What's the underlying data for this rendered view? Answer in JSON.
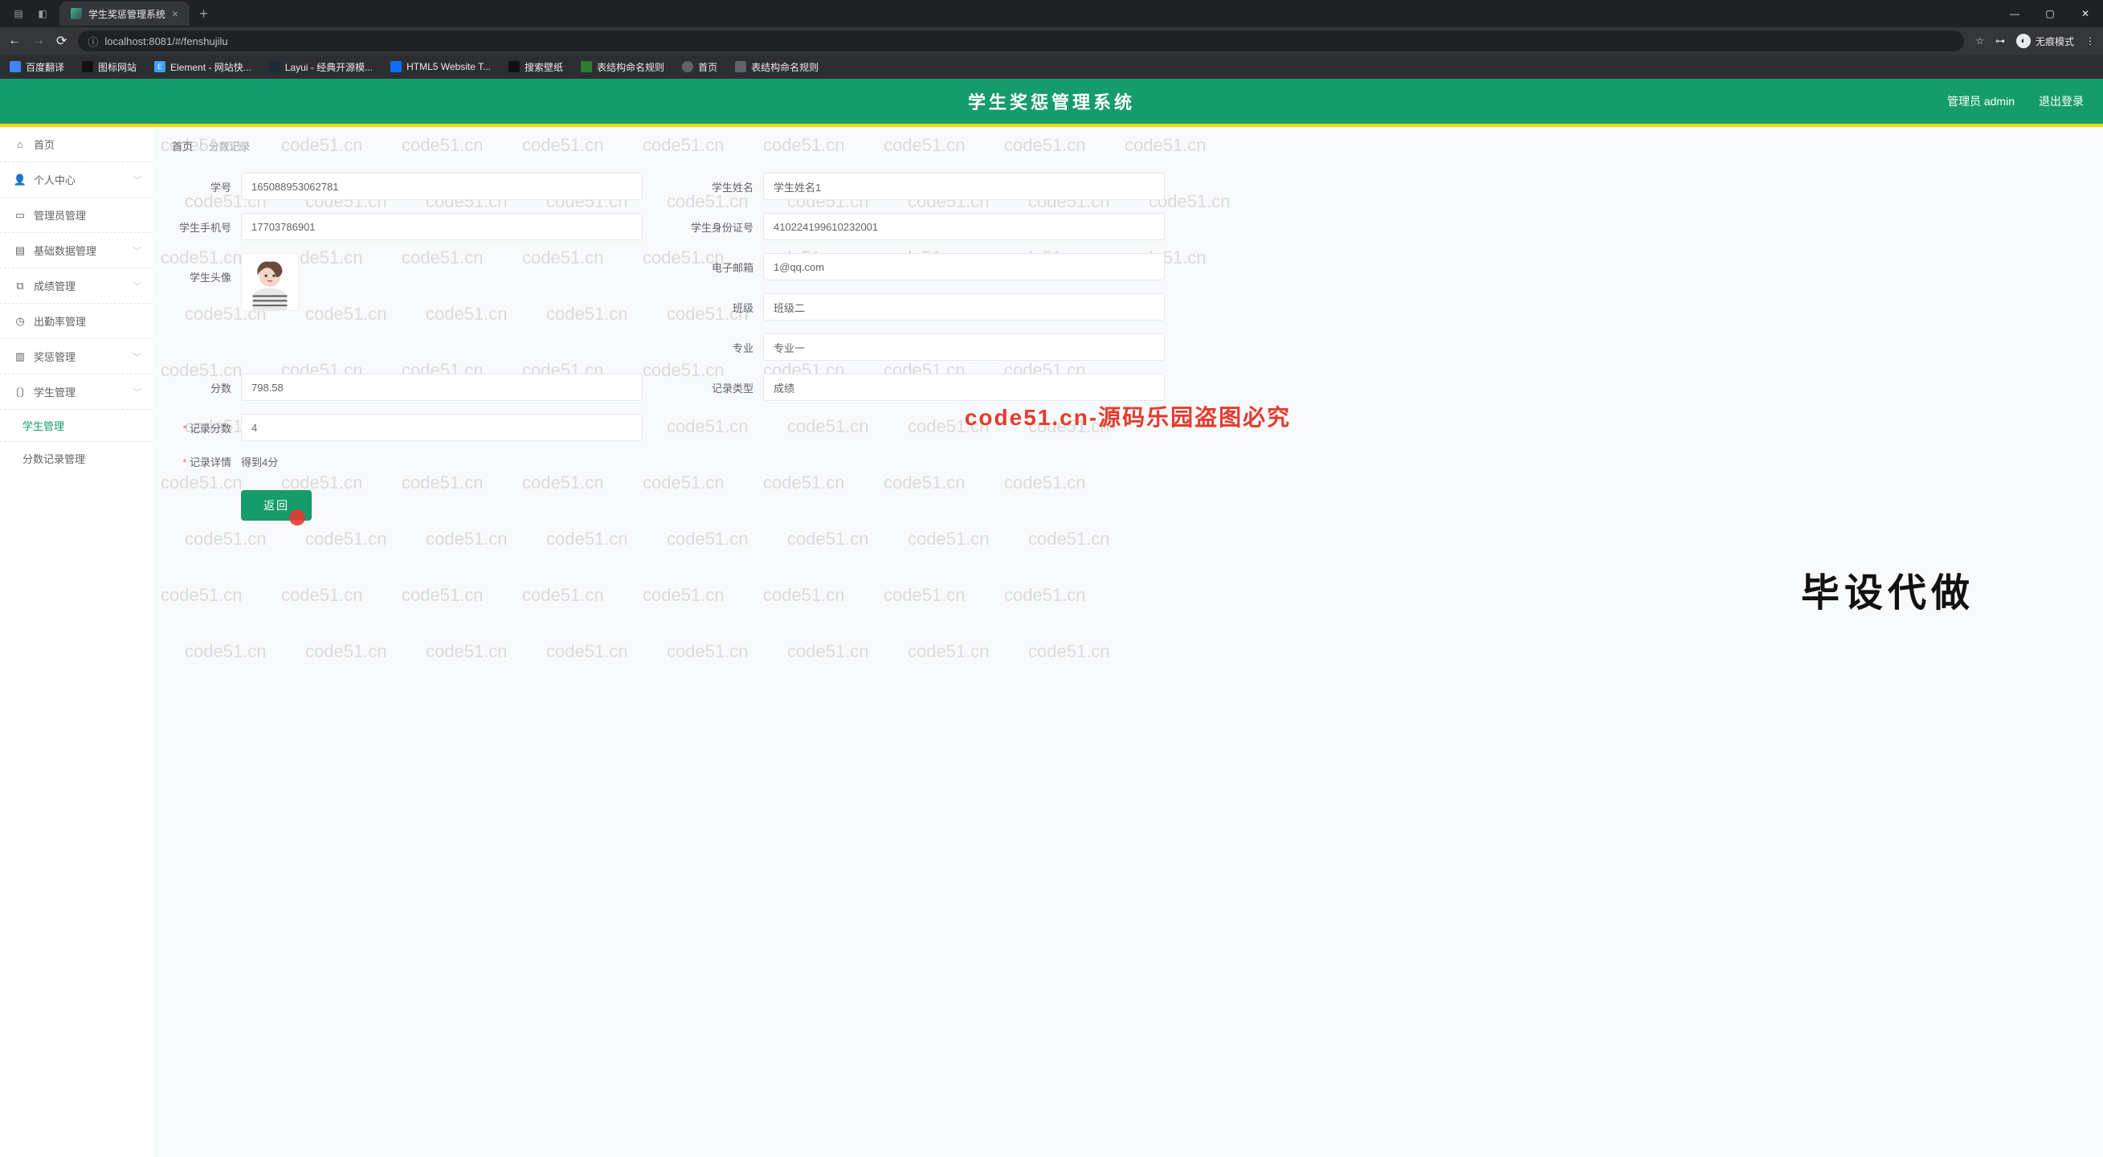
{
  "browser": {
    "tab_title": "学生奖惩管理系统",
    "url": "localhost:8081/#/fenshujilu",
    "incognito": "无痕模式",
    "window_min": "—",
    "window_max": "▢",
    "window_close": "✕"
  },
  "bookmarks": [
    {
      "label": "百度翻译",
      "color": "#4285f4"
    },
    {
      "label": "图标网站",
      "color": "#202124"
    },
    {
      "label": "Element - 网站快...",
      "color": "#409eff"
    },
    {
      "label": "Layui - 经典开源模...",
      "color": "#1e9fff"
    },
    {
      "label": "HTML5 Website T...",
      "color": "#0d6efd"
    },
    {
      "label": "搜索壁纸",
      "color": "#202124"
    },
    {
      "label": "表结构命名规则",
      "color": "#2e7d32"
    },
    {
      "label": "首页",
      "color": "#5f6368"
    },
    {
      "label": "表结构命名规则",
      "color": "#5f6368"
    }
  ],
  "header": {
    "title": "学生奖惩管理系统",
    "admin": "管理员 admin",
    "logout": "退出登录"
  },
  "sidebar": {
    "items": [
      {
        "icon": "home-icon",
        "label": "首页",
        "caret": false
      },
      {
        "icon": "user-icon",
        "label": "个人中心",
        "caret": true
      },
      {
        "icon": "card-icon",
        "label": "管理员管理",
        "caret": false
      },
      {
        "icon": "layers-icon",
        "label": "基础数据管理",
        "caret": true
      },
      {
        "icon": "copy-icon",
        "label": "成绩管理",
        "caret": true
      },
      {
        "icon": "clock-icon",
        "label": "出勤率管理",
        "caret": false
      },
      {
        "icon": "box-icon",
        "label": "奖惩管理",
        "caret": true
      },
      {
        "icon": "bracket-icon",
        "label": "学生管理",
        "caret": true
      }
    ],
    "sub_active": "学生管理",
    "sub_item": "分数记录管理"
  },
  "breadcrumb": {
    "home": "首页",
    "current": "分数记录"
  },
  "form": {
    "student_no_label": "学号",
    "student_no": "165088953062781",
    "student_name_label": "学生姓名",
    "student_name": "学生姓名1",
    "phone_label": "学生手机号",
    "phone": "17703786901",
    "idcard_label": "学生身份证号",
    "idcard": "410224199610232001",
    "avatar_label": "学生头像",
    "email_label": "电子邮箱",
    "email": "1@qq.com",
    "class_label": "班级",
    "class": "班级二",
    "major_label": "专业",
    "major": "专业一",
    "score_label": "分数",
    "score": "798.58",
    "record_type_label": "记录类型",
    "record_type": "成绩",
    "record_score_label": "记录分数",
    "record_score": "4",
    "record_detail_label": "记录详情",
    "record_detail": "得到4分",
    "back_btn": "返回"
  },
  "watermarks": {
    "repeat": "code51.cn",
    "center": "code51.cn-源码乐园盗图必究",
    "big": "毕设代做"
  }
}
